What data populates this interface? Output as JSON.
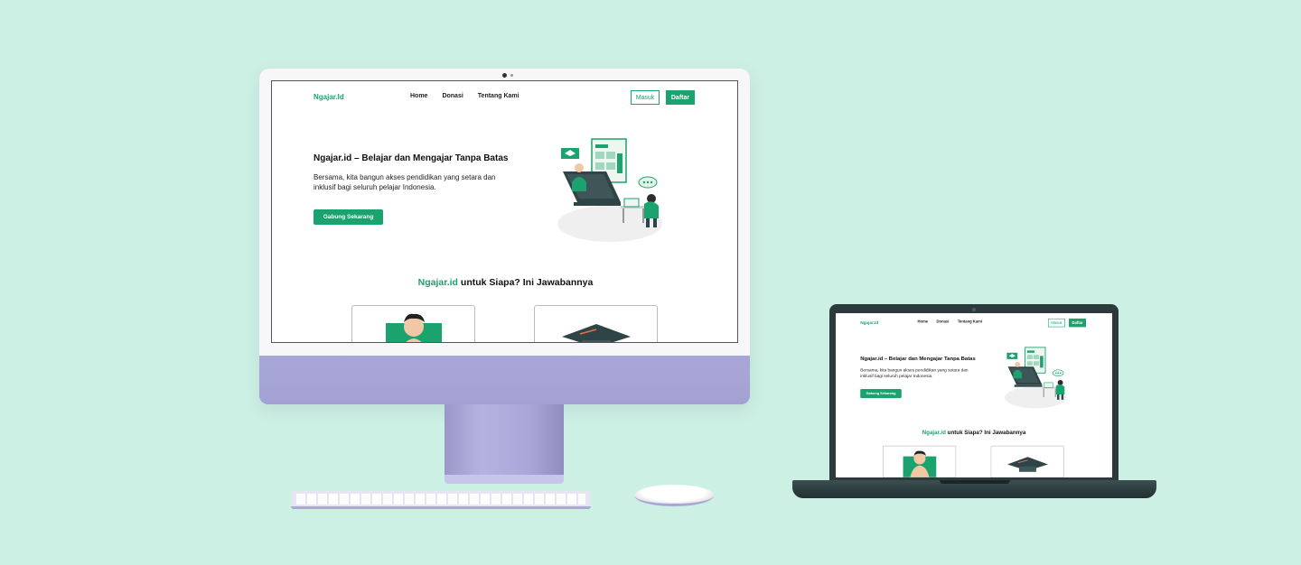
{
  "site": {
    "logo": "Ngajar.Id",
    "nav": [
      {
        "label": "Home"
      },
      {
        "label": "Donasi"
      },
      {
        "label": "Tentang Kami"
      }
    ],
    "login_label": "Masuk",
    "register_label": "Daftar",
    "hero": {
      "title": "Ngajar.id – Belajar dan Mengajar Tanpa Batas",
      "subtitle": "Bersama, kita bangun akses pendidikan yang setara dan inklusif bagi seluruh pelajar Indonesia.",
      "cta_label": "Gabung Sekarang"
    },
    "section": {
      "title_accent": "Ngajar.id",
      "title_rest": " untuk Siapa? Ini Jawabannya"
    }
  },
  "colors": {
    "background": "#cdf0e4",
    "brand": "#1aa36f",
    "imac_body": "#a8a6d6",
    "laptop_body": "#2c3a3c"
  }
}
